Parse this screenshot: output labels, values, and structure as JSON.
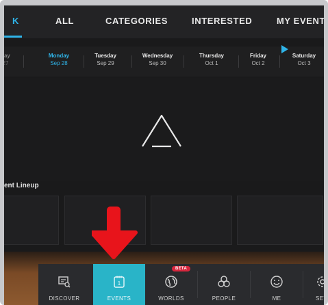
{
  "topnav": {
    "tabs": [
      {
        "label": "K",
        "active": true
      },
      {
        "label": "ALL",
        "active": false
      },
      {
        "label": "CATEGORIES",
        "active": false
      },
      {
        "label": "INTERESTED",
        "active": false
      },
      {
        "label": "MY EVENTS",
        "active": false
      }
    ]
  },
  "days": [
    {
      "name": "day",
      "date": "27"
    },
    {
      "name": "Monday",
      "date": "Sep 28",
      "selected": true
    },
    {
      "name": "Tuesday",
      "date": "Sep 29"
    },
    {
      "name": "Wednesday",
      "date": "Sep 30"
    },
    {
      "name": "Thursday",
      "date": "Oct 1"
    },
    {
      "name": "Friday",
      "date": "Oct 2"
    },
    {
      "name": "Saturday",
      "date": "Oct 3"
    }
  ],
  "lineup": {
    "title": "ent Lineup"
  },
  "bottomnav": {
    "items": [
      {
        "label": "DISCOVER",
        "icon": "discover-icon"
      },
      {
        "label": "EVENTS",
        "icon": "calendar-icon",
        "active": true,
        "calendar_number": "1"
      },
      {
        "label": "WORLDS",
        "icon": "globe-icon"
      },
      {
        "label": "PEOPLE",
        "icon": "people-icon"
      },
      {
        "label": "ME",
        "icon": "smiley-icon"
      },
      {
        "label": "SET",
        "icon": "gear-icon"
      }
    ],
    "beta_badge": "BETA"
  },
  "colors": {
    "accent": "#2fb4e9",
    "active_tab_bg": "#29b4c8",
    "arrow": "#e8141b",
    "beta": "#d7263d"
  }
}
